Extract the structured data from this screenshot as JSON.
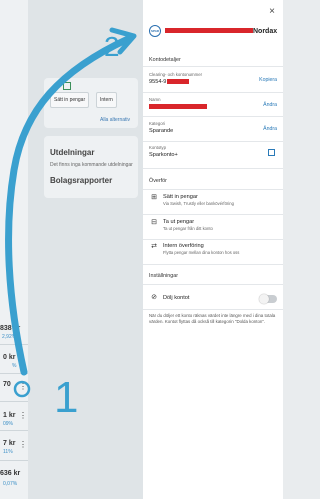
{
  "background": {
    "button_deposit": "Sätt in pengar",
    "button_internal": "Intern",
    "all_alternatives_link": "Alla alternativ",
    "dividends_title": "Utdelningar",
    "dividends_text": "Det finns inga kommande utdelningar",
    "reports_title": "Bolagsrapporter",
    "left_values": [
      {
        "value": "838 kr",
        "pct": "2,92%"
      },
      {
        "value": "0 kr",
        "pct": "%"
      },
      {
        "value": "70",
        "pct": ""
      },
      {
        "value": "1 kr",
        "pct": "09%"
      },
      {
        "value": "7 kr",
        "pct": "11%"
      },
      {
        "value": "636 kr",
        "pct": "0,07%"
      }
    ]
  },
  "panel": {
    "close_label": "×",
    "account_icon_text": "SPAR",
    "account_name_suffix": "Nordax",
    "details_header": "Kontodetaljer",
    "clearing": {
      "label": "Clearing- och kontonummer",
      "value": "9554-9",
      "action": "Kopiera"
    },
    "name": {
      "label": "Namn",
      "action": "Ändra"
    },
    "category": {
      "label": "Kategori",
      "value": "Sparande",
      "action": "Ändra"
    },
    "account_type": {
      "label": "Kontotyp",
      "value": "Sparkonto+"
    },
    "transfer_header": "Överför",
    "transfer_items": [
      {
        "icon": "deposit-icon",
        "title": "Sätt in pengar",
        "subtitle": "Via Swish, Trustly eller bankövérföring"
      },
      {
        "icon": "withdraw-icon",
        "title": "Ta ut pengar",
        "subtitle": "Ta ut pengar från ditt konto"
      },
      {
        "icon": "transfer-icon",
        "title": "Intern överföring",
        "subtitle": "Flytta pengar mellan dina konton hos oss"
      }
    ],
    "settings_header": "Inställningar",
    "hide_account_label": "Dölj kontot",
    "hide_account_on": false,
    "hide_description": "När du döljer ett konto räknas värdet inte längre med i dina totala värden. Kontot flyttas då också till kategorin \"Dolda konton\"."
  },
  "annotations": {
    "label_one": "1",
    "label_two": "2"
  },
  "colors": {
    "accent": "#2a7ab8",
    "annotation": "#3aa0cf",
    "redaction": "#d9262b"
  }
}
